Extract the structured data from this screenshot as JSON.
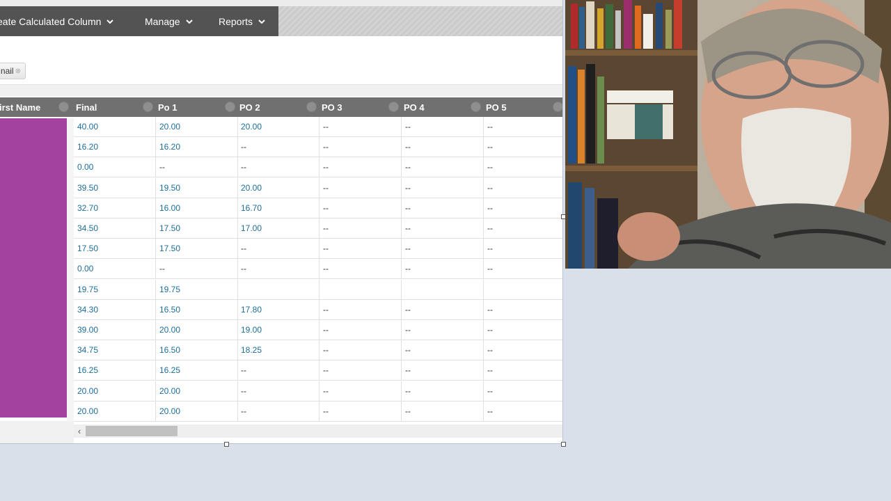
{
  "menu": {
    "items": [
      {
        "label": "eate Calculated Column"
      },
      {
        "label": "Manage"
      },
      {
        "label": "Reports"
      }
    ]
  },
  "toolbar": {
    "email_label": "nail",
    "email_remove": "⊗"
  },
  "grid": {
    "headers": [
      "irst Name",
      "Final",
      "Po 1",
      "PO 2",
      "PO 3",
      "PO 4",
      "PO 5"
    ],
    "rows": [
      [
        "40.00",
        "20.00",
        "20.00",
        "--",
        "--",
        "--"
      ],
      [
        "16.20",
        "16.20",
        "--",
        "--",
        "--",
        "--"
      ],
      [
        "0.00",
        "--",
        "--",
        "--",
        "--",
        "--"
      ],
      [
        "39.50",
        "19.50",
        "20.00",
        "--",
        "--",
        "--"
      ],
      [
        "32.70",
        "16.00",
        "16.70",
        "--",
        "--",
        "--"
      ],
      [
        "34.50",
        "17.50",
        "17.00",
        "--",
        "--",
        "--"
      ],
      [
        "17.50",
        "17.50",
        "--",
        "--",
        "--",
        "--"
      ],
      [
        "0.00",
        "--",
        "--",
        "--",
        "--",
        "--"
      ],
      [
        "19.75",
        "19.75",
        "",
        "",
        "",
        ""
      ],
      [
        "34.30",
        "16.50",
        "17.80",
        "--",
        "--",
        "--"
      ],
      [
        "39.00",
        "20.00",
        "19.00",
        "--",
        "--",
        "--"
      ],
      [
        "34.75",
        "16.50",
        "18.25",
        "--",
        "--",
        "--"
      ],
      [
        "16.25",
        "16.25",
        "--",
        "--",
        "--",
        "--"
      ],
      [
        "20.00",
        "20.00",
        "--",
        "--",
        "--",
        "--"
      ],
      [
        "20.00",
        "20.00",
        "--",
        "--",
        "--",
        "--"
      ]
    ]
  },
  "scrollbar": {
    "left_arrow": "‹"
  },
  "colors": {
    "menubar": "#535353",
    "header": "#707070",
    "link_value": "#1d6d9a",
    "name_block": "#a4429f"
  }
}
